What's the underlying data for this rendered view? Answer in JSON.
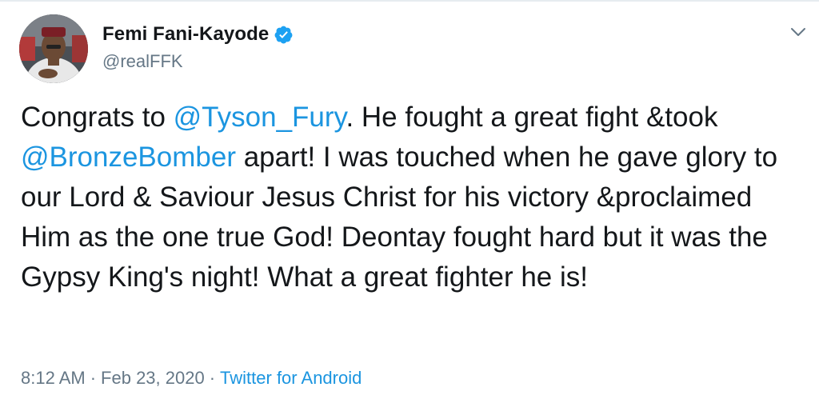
{
  "author": {
    "display_name": "Femi Fani-Kayode",
    "handle": "@realFFK",
    "verified": true,
    "avatar_icon": "profile-photo"
  },
  "tweet": {
    "segments": [
      {
        "text": "Congrats to ",
        "type": "text"
      },
      {
        "text": "@Tyson_Fury",
        "type": "mention"
      },
      {
        "text": ". He fought a great fight &took ",
        "type": "text"
      },
      {
        "text": "@BronzeBomber",
        "type": "mention"
      },
      {
        "text": " apart! I was touched when he gave glory to our Lord & Saviour Jesus Christ for his victory &proclaimed Him as the one true God! Deontay fought hard but it was the Gypsy King's night! What a great fighter he is!",
        "type": "text"
      }
    ]
  },
  "meta": {
    "time": "8:12 AM",
    "separator": "·",
    "date": "Feb 23, 2020",
    "source": "Twitter for Android"
  },
  "colors": {
    "text": "#14171a",
    "muted": "#657786",
    "link": "#1b95e0",
    "verified": "#1da1f2"
  },
  "icons": {
    "verified": "verified-badge-icon",
    "caret": "chevron-down-icon"
  }
}
